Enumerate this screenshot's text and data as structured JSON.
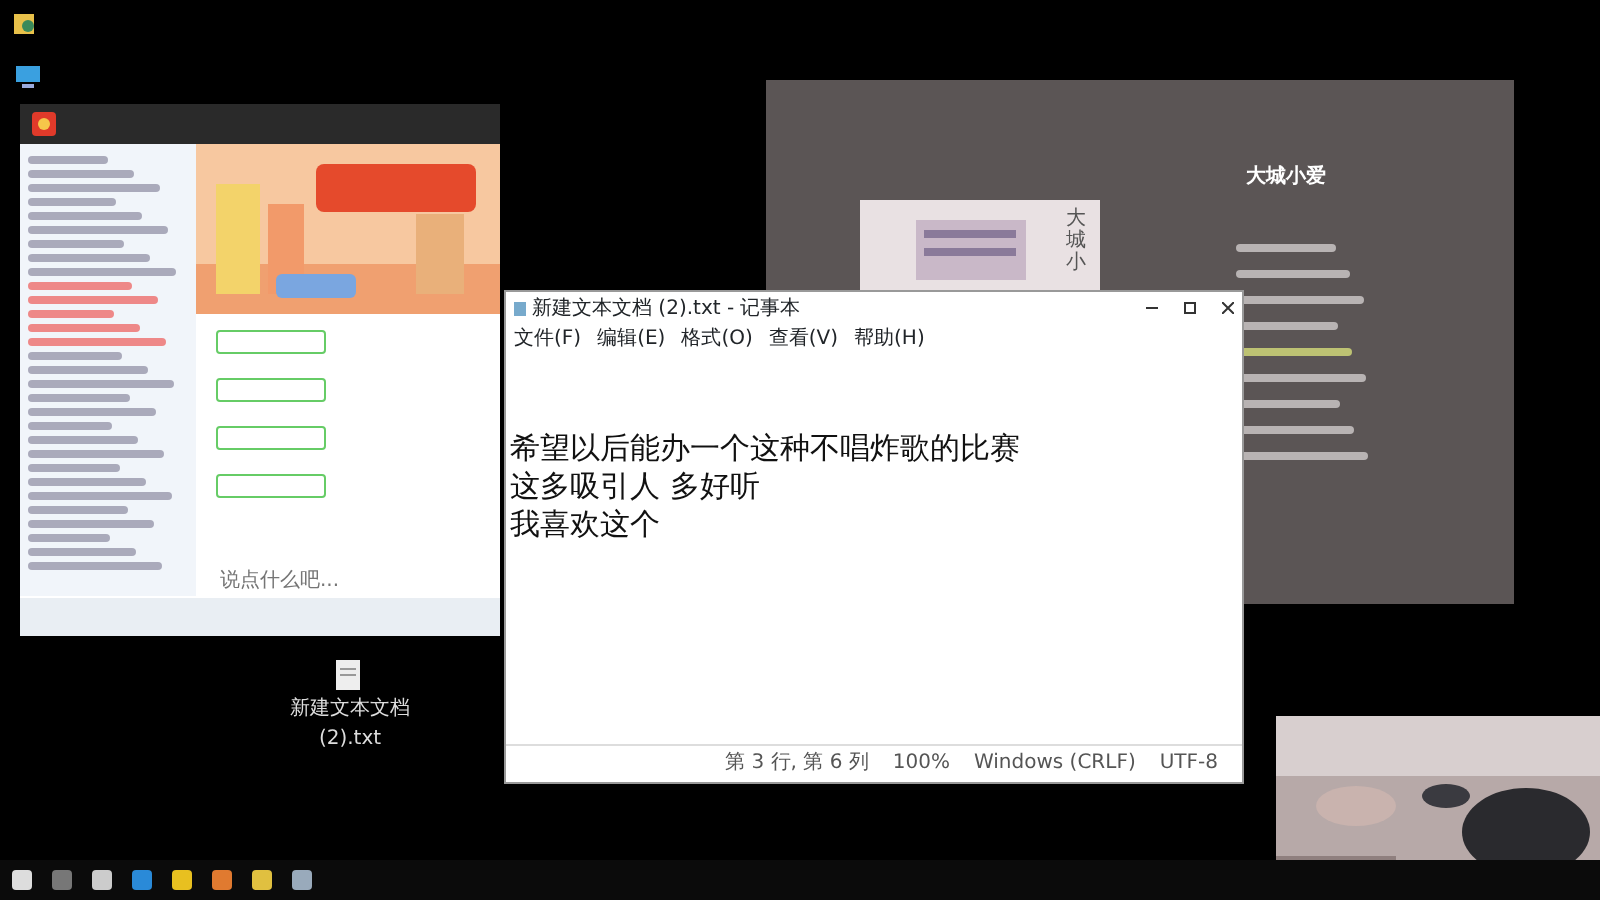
{
  "chat_window": {
    "input": {
      "placeholder": "说点什么吧..."
    }
  },
  "music_player": {
    "song_title": "大城小爱",
    "cover_text": "大城小",
    "lyrics": [
      {
        "highlighted": false
      },
      {
        "highlighted": false
      },
      {
        "highlighted": false
      },
      {
        "highlighted": false
      },
      {
        "highlighted": true
      },
      {
        "highlighted": false
      },
      {
        "highlighted": false
      },
      {
        "highlighted": false
      },
      {
        "highlighted": false
      }
    ]
  },
  "notepad": {
    "title": "新建文本文档 (2).txt - 记事本",
    "menu": [
      "文件(F)",
      "编辑(E)",
      "格式(O)",
      "查看(V)",
      "帮助(H)"
    ],
    "lines": [
      "希望以后能办一个这种不唱炸歌的比赛",
      "这多吸引人 多好听",
      "我喜欢这个"
    ],
    "status": [
      "第 3 行, 第 6 列",
      "100%",
      "Windows (CRLF)",
      "UTF-8"
    ]
  },
  "desktop_icon": {
    "label": "新建文本文档 (2).txt"
  }
}
